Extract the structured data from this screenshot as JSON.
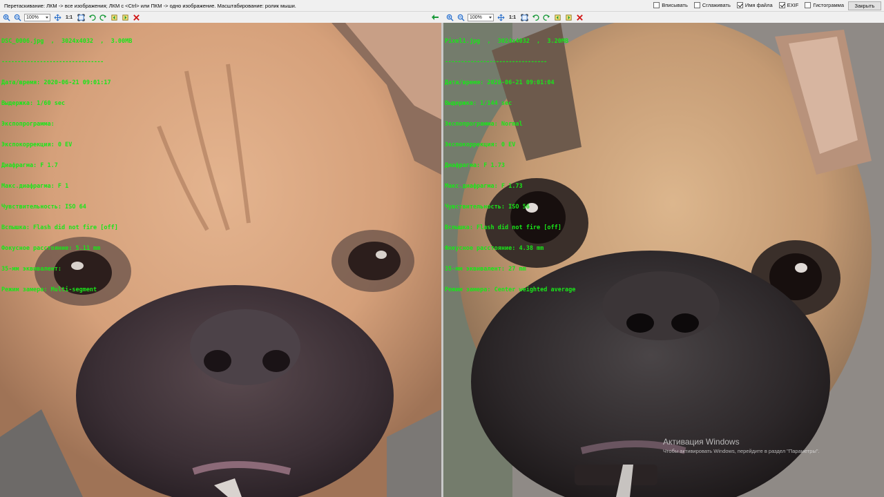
{
  "hint": "Перетаскивание: ЛКМ -> все изображения; ЛКМ с <Ctrl> или ПКМ -> одно изображение. Масштабирование: ролик мыши.",
  "options": [
    {
      "label": "Вписывать",
      "checked": false
    },
    {
      "label": "Сглаживать",
      "checked": false
    },
    {
      "label": "Имя файла",
      "checked": true
    },
    {
      "label": "EXIF",
      "checked": true
    },
    {
      "label": "Гистограмма",
      "checked": false
    }
  ],
  "close_label": "Закрыть",
  "toolbar": {
    "zoom_value": "100%",
    "one_to_one": "1:1",
    "icons": [
      "zoom-in-icon",
      "zoom-out-icon",
      "fit-icon",
      "fit-window-icon",
      "rotate-left-icon",
      "rotate-right-icon",
      "prev-image-icon",
      "next-image-icon",
      "close-image-icon"
    ],
    "back_icon": "back-arrow-icon"
  },
  "left": {
    "filename": "DSC_0006.jpg  ,  3024x4032  ,  3.00MB",
    "separator": "--------------------------------",
    "exif": [
      "Дата/время: 2020-06-21 09:01:17",
      "Выдержка: 1/60 sec",
      "Экспопрограмма: ",
      "Экспокоррекция: 0 EV",
      "Диафрагма: F 1.7",
      "Макс.диафрагма: F 1",
      "Чувствительность: ISO 64",
      "Вспышка: Flash did not fire [off]",
      "Фокусное расстояние: 5.11 mm",
      "35-мм эквивалент:",
      "Режим замера: Multi-segment"
    ]
  },
  "right": {
    "filename": "Pixel1.jpg  ,  3024x4032  ,  3.20MB",
    "separator": "--------------------------------",
    "exif": [
      "Дата/время: 2020-06-21 09:01:04",
      "Выдержка: 1/144 sec",
      "Экспопрограмма: Normal",
      "Экспокоррекция: 0 EV",
      "Диафрагма: F 1.73",
      "Макс.диафрагма: F 1.73",
      "Чувствительность: ISO 56",
      "Вспышка: Flash did not fire [off]",
      "Фокусное расстояние: 4.38 mm",
      "35-мм эквивалент: 27 mm",
      "Режим замера: Center weighted average"
    ]
  },
  "watermark": {
    "title": "Активация Windows",
    "subtitle": "Чтобы активировать Windows, перейдите в раздел \"Параметры\"."
  },
  "colors": {
    "exif_text": "#19e619",
    "close_icon": "#d11a1a",
    "nav_icon": "#1a9a3a",
    "zoom_icon": "#2a6fc9"
  }
}
